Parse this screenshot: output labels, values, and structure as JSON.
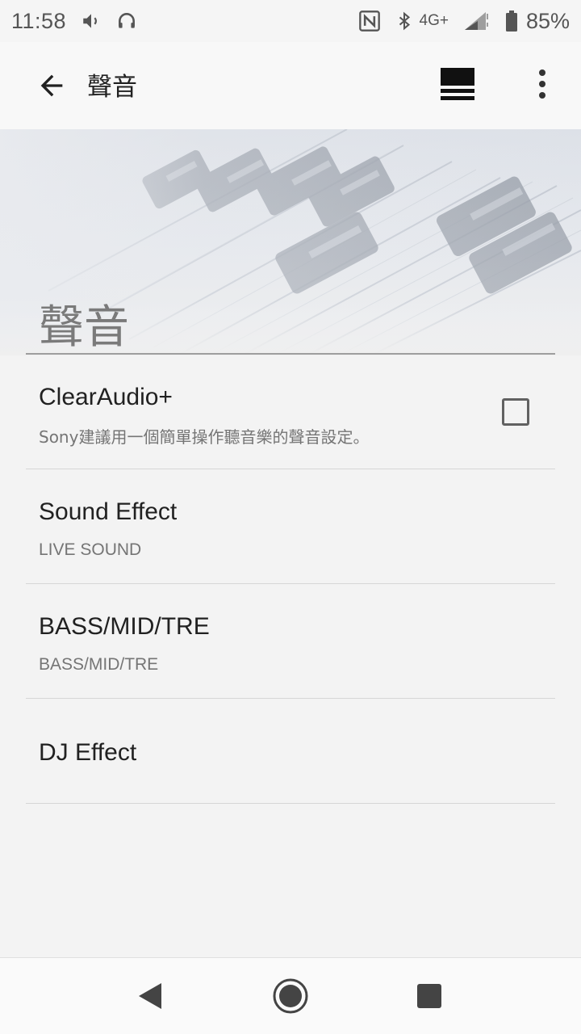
{
  "status_bar": {
    "time": "11:58",
    "network": "4G+",
    "battery": "85%",
    "icons": [
      "volume-icon",
      "headphones-icon",
      "nfc-icon",
      "bluetooth-icon",
      "signal-icon",
      "battery-icon"
    ]
  },
  "app_bar": {
    "title": "聲音",
    "icons": [
      "back-arrow-icon",
      "menu-bars-icon",
      "more-vert-icon"
    ]
  },
  "banner": {
    "title": "聲音"
  },
  "preferences": [
    {
      "title": "ClearAudio+",
      "summary": "Sony建議用一個簡單操作聽音樂的聲音設定。",
      "checked": false
    },
    {
      "title": "Sound Effect",
      "summary": "LIVE SOUND"
    },
    {
      "title": "BASS/MID/TRE",
      "summary": "BASS/MID/TRE"
    },
    {
      "title": "DJ Effect",
      "summary": ""
    }
  ],
  "nav_bar": {
    "icons": [
      "nav-back-icon",
      "nav-home-icon",
      "nav-recents-icon"
    ]
  },
  "colors": {
    "background": "#f3f3f3",
    "text_primary": "#212121",
    "text_secondary": "#757575",
    "banner_title": "#7a7a7a"
  }
}
